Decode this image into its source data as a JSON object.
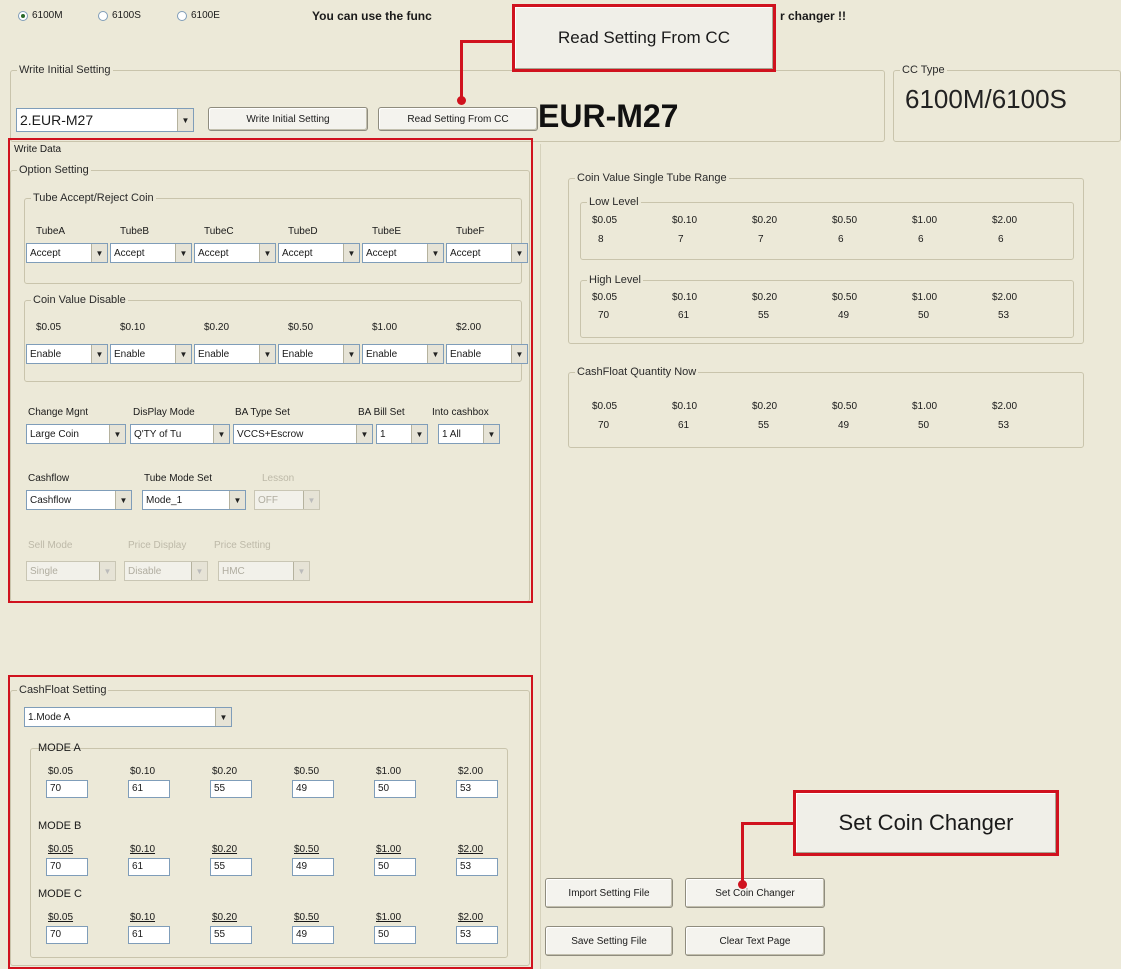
{
  "model_radio": [
    {
      "label": "6100M",
      "selected": true
    },
    {
      "label": "6100S",
      "selected": false
    },
    {
      "label": "6100E",
      "selected": false
    }
  ],
  "header_notice_left": "You can use the func",
  "header_notice_right": "r changer !!",
  "write_initial": {
    "group_label": "Write Initial Setting",
    "selected": "2.EUR-M27",
    "write_button": "Write Initial Setting",
    "read_button": "Read Setting From CC",
    "big_display": "EUR-M27"
  },
  "cc_type": {
    "label": "CC Type",
    "value": "6100M/6100S"
  },
  "write_data": {
    "group_label": "Write Data",
    "option_setting": "Option Setting",
    "tube_accept": {
      "label": "Tube Accept/Reject Coin",
      "tubes": [
        "TubeA",
        "TubeB",
        "TubeC",
        "TubeD",
        "TubeE",
        "TubeF"
      ],
      "values": [
        "Accept",
        "Accept",
        "Accept",
        "Accept",
        "Accept",
        "Accept"
      ]
    },
    "coin_disable": {
      "label": "Coin Value Disable",
      "coins": [
        "$0.05",
        "$0.10",
        "$0.20",
        "$0.50",
        "$1.00",
        "$2.00"
      ],
      "values": [
        "Enable",
        "Enable",
        "Enable",
        "Enable",
        "Enable",
        "Enable"
      ]
    },
    "row3": {
      "labels": [
        "Change Mgnt",
        "DisPlay Mode",
        "BA Type Set",
        "BA Bill Set",
        "Into cashbox"
      ],
      "values": [
        "Large Coin",
        "Q'TY of Tu",
        "VCCS+Escrow",
        "1",
        "1 All"
      ]
    },
    "row4": {
      "labels": [
        "Cashflow",
        "Tube Mode Set",
        "Lesson"
      ],
      "values": [
        "Cashflow",
        "Mode_1",
        "OFF"
      ]
    },
    "row5": {
      "labels": [
        "Sell Mode",
        "Price Display",
        "Price Setting"
      ],
      "values": [
        "Single",
        "Disable",
        "HMC"
      ]
    }
  },
  "tube_range": {
    "label": "Coin Value Single Tube Range",
    "coins": [
      "$0.05",
      "$0.10",
      "$0.20",
      "$0.50",
      "$1.00",
      "$2.00"
    ],
    "low_label": "Low Level",
    "low": [
      "8",
      "7",
      "7",
      "6",
      "6",
      "6"
    ],
    "high_label": "High Level",
    "high": [
      "70",
      "61",
      "55",
      "49",
      "50",
      "53"
    ]
  },
  "cashfloat_now": {
    "label": "CashFloat Quantity Now",
    "coins": [
      "$0.05",
      "$0.10",
      "$0.20",
      "$0.50",
      "$1.00",
      "$2.00"
    ],
    "values": [
      "70",
      "61",
      "55",
      "49",
      "50",
      "53"
    ]
  },
  "cashfloat_setting": {
    "label": "CashFloat Setting",
    "selected": "1.Mode A",
    "coins": [
      "$0.05",
      "$0.10",
      "$0.20",
      "$0.50",
      "$1.00",
      "$2.00"
    ],
    "modes": [
      {
        "label": "MODE A",
        "values": [
          "70",
          "61",
          "55",
          "49",
          "50",
          "53"
        ]
      },
      {
        "label": "MODE B",
        "values": [
          "70",
          "61",
          "55",
          "49",
          "50",
          "53"
        ]
      },
      {
        "label": "MODE C",
        "values": [
          "70",
          "61",
          "55",
          "49",
          "50",
          "53"
        ]
      }
    ]
  },
  "buttons": {
    "import": "Import Setting File",
    "set_cc": "Set Coin Changer",
    "save": "Save Setting File",
    "clear": "Clear Text Page"
  },
  "callouts": {
    "read": "Read Setting From CC",
    "set": "Set  Coin Changer"
  },
  "colors": {
    "highlight": "#d0121e",
    "window": "#ece9d8"
  }
}
